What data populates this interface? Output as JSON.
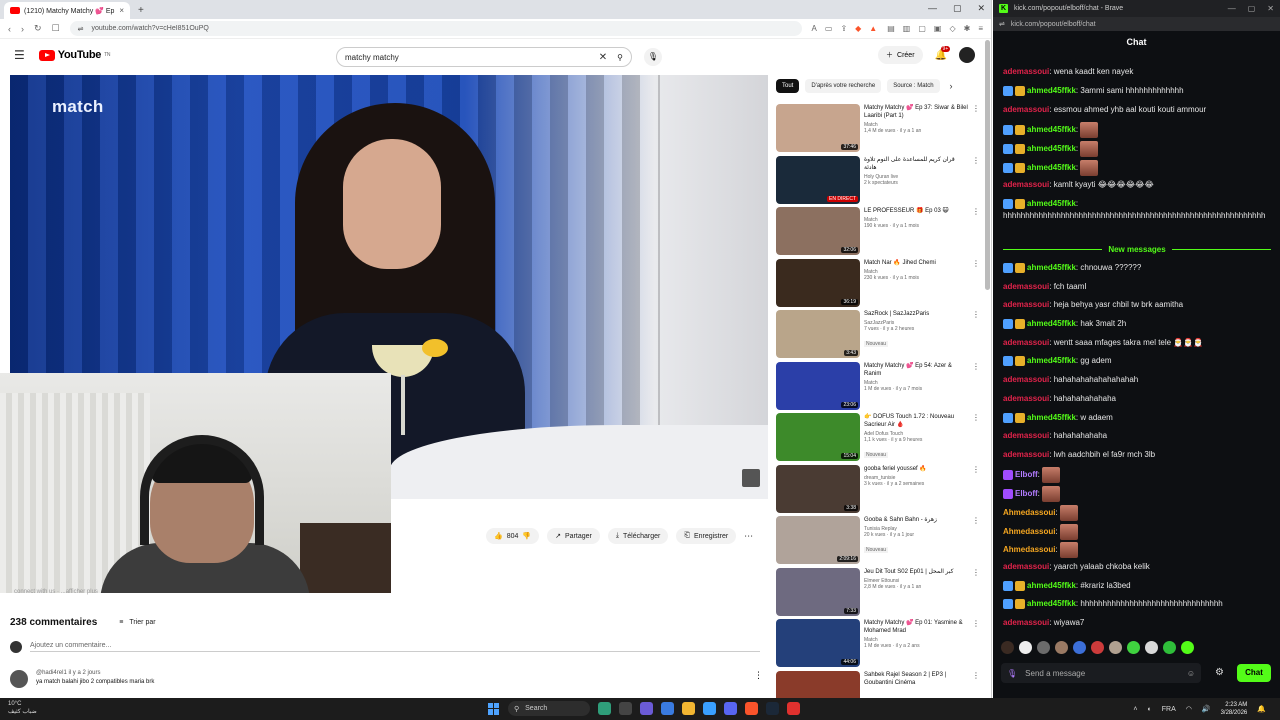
{
  "left_browser": {
    "tab": {
      "title": "(1210) Matchy Matchy 💕 Ep",
      "close": "×"
    },
    "new_tab": "+",
    "window_controls": [
      "—",
      "▢",
      "✕"
    ],
    "url": "youtube.com/watch?v=cHeI851OuPQ"
  },
  "youtube": {
    "logo_text": "YouTube",
    "logo_sup": "TN",
    "search": {
      "value": "matchy matchy",
      "clear": "✕"
    },
    "create_label": "Créer",
    "notif_count": "9+",
    "video": {
      "watermark": "match"
    },
    "actions": {
      "likes": "804",
      "share": "Partager",
      "download": "Télécharger",
      "save": "Enregistrer",
      "more": "⋯"
    },
    "description_stub": "connect with us  ·  ...afficher plus",
    "comments": {
      "count_label": "238 commentaires",
      "sort_label": "Trier par",
      "add_placeholder": "Ajoutez un commentaire...",
      "items": [
        {
          "author": "@hadi4rel1",
          "time": "il y a 2 jours",
          "text": "ya match balahi jibo 2 compatibles maria brk"
        }
      ]
    },
    "chips": [
      {
        "label": "Tout",
        "active": true
      },
      {
        "label": "D'après votre recherche",
        "active": false
      },
      {
        "label": "Source : Match",
        "active": false
      }
    ],
    "chip_next": "›",
    "recommendations": [
      {
        "title": "Matchy Matchy 💕 Ep 37: Siwar & Bilel Laaribi (Part 1)",
        "channel": "Match",
        "meta": "1,4 M de vues · il y a 1 an",
        "duration": "37:46",
        "badge": "",
        "thumb_color": "#c7a58e"
      },
      {
        "title": "قرآن كريم للمساعدة على النوم تلاوة هادئة",
        "channel": "Holy Quran live",
        "meta": "2 k spectateurs",
        "duration": "EN DIRECT",
        "badge": "",
        "thumb_color": "#1a2a3a"
      },
      {
        "title": "LE PROFESSEUR 🎁 Ep 03 😺",
        "channel": "Match",
        "meta": "190 k vues · il y a 1 mois",
        "duration": "32:06",
        "badge": "",
        "thumb_color": "#8c7060"
      },
      {
        "title": "Match Nar 🔥 Jihed Chemi",
        "channel": "Match",
        "meta": "230 k vues · il y a 1 mois",
        "duration": "36:19",
        "badge": "",
        "thumb_color": "#3a2a1e"
      },
      {
        "title": "SazRock | SazJazzParis",
        "channel": "SazJazzParis",
        "meta": "7 vues · il y a 2 heures",
        "duration": "3:43",
        "badge": "Nouveau",
        "thumb_color": "#b9a58a"
      },
      {
        "title": "Matchy Matchy 💕 Ep 54: Azer & Ranim",
        "channel": "Match",
        "meta": "1 M de vues · il y a 7 mois",
        "duration": "23:06",
        "badge": "",
        "thumb_color": "#2b3fa8"
      },
      {
        "title": "👉 DOFUS Touch 1.72 : Nouveau Sacrieur Air 🩸",
        "channel": "Adel Dofus Touch",
        "meta": "1,1 k vues · il y a 9 heures",
        "duration": "15:04",
        "badge": "Nouveau",
        "thumb_color": "#3d8a2a"
      },
      {
        "title": "gooba feriel youssef 🔥",
        "channel": "dream_tunisie",
        "meta": "3 k vues · il y a 2 semaines",
        "duration": "3:38",
        "badge": "",
        "thumb_color": "#4a3b33"
      },
      {
        "title": "Gooba & Sahn Bahn - زهرة",
        "channel": "Tunisia Replay",
        "meta": "20 k vues · il y a 1 jour",
        "duration": "2:09:16",
        "badge": "Nouveau",
        "thumb_color": "#b0a39a"
      },
      {
        "title": "Jeu Dit Tout S02 Ep01 | كبر المحل",
        "channel": "Elmeer Ettounsi",
        "meta": "2,8 M de vues · il y a 1 an",
        "duration": "7:33",
        "badge": "",
        "thumb_color": "#6e6a80"
      },
      {
        "title": "Matchy Matchy 💕 Ep 01: Yasmine & Mohamed Mrad",
        "channel": "Match",
        "meta": "1 M de vues · il y a 2 ans",
        "duration": "44:06",
        "badge": "",
        "thumb_color": "#24407a"
      },
      {
        "title": "Sahbek Rajel Season 2 | EP3 | Goubantini Cinéma",
        "channel": "",
        "meta": "",
        "duration": "",
        "badge": "",
        "thumb_color": "#8a3b2a"
      }
    ]
  },
  "right_browser": {
    "tab_title": "kick.com/popout/elboff/chat - Brave",
    "url": "kick.com/popout/elboff/chat",
    "window_controls": [
      "—",
      "▢",
      "✕"
    ]
  },
  "chat": {
    "title": "Chat",
    "new_messages_label": "New messages",
    "messages": [
      {
        "user": "ademassoui",
        "color": "red",
        "text": "wena kaadt ken nayek",
        "badges": 0,
        "emote": false
      },
      {
        "user": "ahmed45ffkk",
        "color": "green",
        "text": "3ammi sami hhhhhhhhhhhhh",
        "badges": 2,
        "emote": false
      },
      {
        "user": "ademassoui",
        "color": "red",
        "text": "essmou ahmed yhb aal kouti kouti ammour",
        "badges": 0,
        "emote": false
      },
      {
        "user": "ahmed45ffkk",
        "color": "green",
        "text": "",
        "badges": 2,
        "emote": true
      },
      {
        "user": "ahmed45ffkk",
        "color": "green",
        "text": "",
        "badges": 2,
        "emote": true
      },
      {
        "user": "ahmed45ffkk",
        "color": "green",
        "text": "",
        "badges": 2,
        "emote": true
      },
      {
        "user": "ademassoui",
        "color": "red",
        "text": "kamlt kyayti 😂😂😂😂😂😂",
        "badges": 0,
        "emote": false
      },
      {
        "user": "ahmed45ffkk",
        "color": "green",
        "text": "hhhhhhhhhhhhhhhhhhhhhhhhhhhhhhhhhhhhhhhhhhhhhhhhhhhhhhhhhhh",
        "badges": 2,
        "emote": false
      },
      {
        "user": "ahmed45ffkk",
        "color": "green",
        "text": "chnouwa ??????",
        "badges": 2,
        "emote": false
      },
      {
        "user": "ademassoui",
        "color": "red",
        "text": "fch taamI",
        "badges": 0,
        "emote": false
      },
      {
        "user": "ademassoui",
        "color": "red",
        "text": "heja behya yasr chbil tw brk aamitha",
        "badges": 0,
        "emote": false
      },
      {
        "user": "ahmed45ffkk",
        "color": "green",
        "text": "hak 3malt 2h",
        "badges": 2,
        "emote": false
      },
      {
        "user": "ademassoui",
        "color": "red",
        "text": "wentt saaa mfages takra mel tele 🎅🎅🎅",
        "badges": 0,
        "emote": false
      },
      {
        "user": "ahmed45ffkk",
        "color": "green",
        "text": "gg adem",
        "badges": 2,
        "emote": false
      },
      {
        "user": "ademassoui",
        "color": "red",
        "text": "hahahahahahahahahah",
        "badges": 0,
        "emote": false
      },
      {
        "user": "ademassoui",
        "color": "red",
        "text": "hahahahahahaha",
        "badges": 0,
        "emote": false
      },
      {
        "user": "ahmed45ffkk",
        "color": "green",
        "text": "w adaem",
        "badges": 2,
        "emote": false
      },
      {
        "user": "ademassoui",
        "color": "red",
        "text": "hahahahahaha",
        "badges": 0,
        "emote": false
      },
      {
        "user": "ademassoui",
        "color": "red",
        "text": "lwh aadchbih el fa9r mch 3lb",
        "badges": 0,
        "emote": false
      },
      {
        "user": "Elboff",
        "color": "purple",
        "text": "",
        "badges": 3,
        "emote": true
      },
      {
        "user": "Elboff",
        "color": "purple",
        "text": "",
        "badges": 3,
        "emote": true
      },
      {
        "user": "Ahmedassoui",
        "color": "orange",
        "text": "",
        "badges": 0,
        "emote": true
      },
      {
        "user": "Ahmedassoui",
        "color": "orange",
        "text": "",
        "badges": 0,
        "emote": true
      },
      {
        "user": "Ahmedassoui",
        "color": "orange",
        "text": "",
        "badges": 0,
        "emote": true
      },
      {
        "user": "ademassoui",
        "color": "red",
        "text": "yaarch yalaab chkoba kelik",
        "badges": 0,
        "emote": false
      },
      {
        "user": "ahmed45ffkk",
        "color": "green",
        "text": "#krariz la3bed",
        "badges": 2,
        "emote": false
      },
      {
        "user": "ahmed45ffkk",
        "color": "green",
        "text": "hhhhhhhhhhhhhhhhhhhhhhhhhhhhhhhh",
        "badges": 2,
        "emote": false
      },
      {
        "user": "ademassoui",
        "color": "red",
        "text": "wiyawa7",
        "badges": 0,
        "emote": false
      }
    ],
    "input_placeholder": "Send a message",
    "send_label": "Chat",
    "colors": {
      "green": "#53fc18",
      "red": "#e2234b",
      "purple": "#b27cff",
      "orange": "#f6a721"
    }
  },
  "taskbar": {
    "weather_temp": "10°C",
    "weather_text": "ضباب كثيف",
    "search_label": "Search",
    "time": "2:23 AM",
    "date": "3/28/2026",
    "lang": "FRA"
  }
}
